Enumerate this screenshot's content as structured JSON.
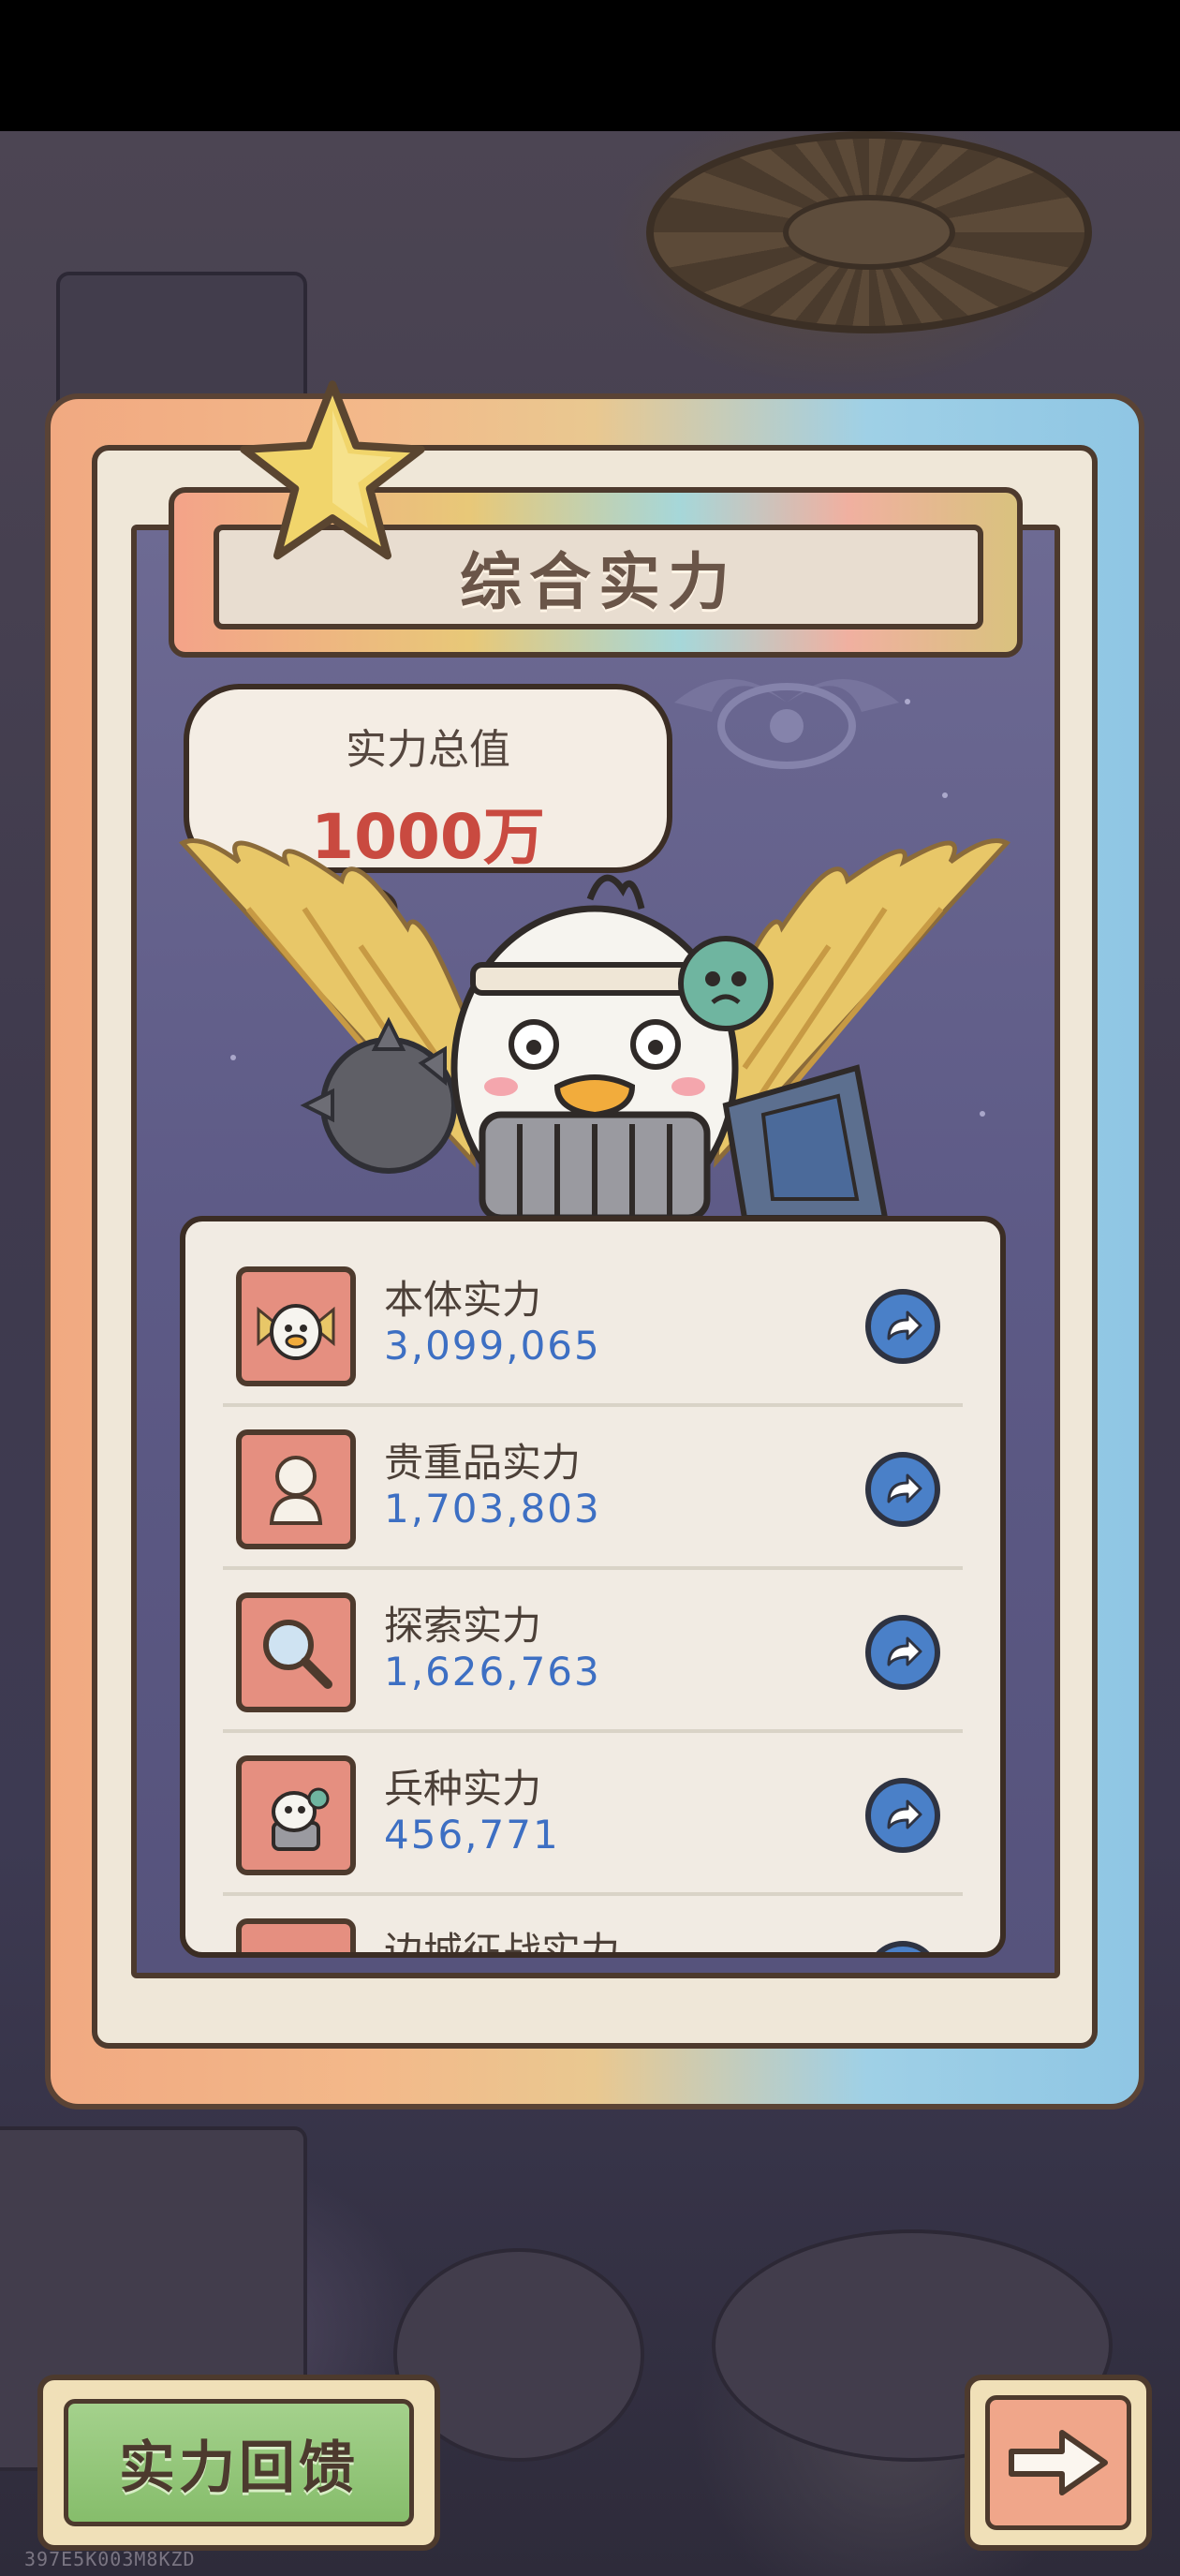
{
  "panel": {
    "title": "综合实力",
    "total_label": "实力总值",
    "total_value": "1000万"
  },
  "stats": [
    {
      "name": "本体实力",
      "value": "3,099,065",
      "icon": "duck-knight-icon"
    },
    {
      "name": "贵重品实力",
      "value": "1,703,803",
      "icon": "statue-bust-icon"
    },
    {
      "name": "探索实力",
      "value": "1,626,763",
      "icon": "magnifier-icon"
    },
    {
      "name": "兵种实力",
      "value": "456,771",
      "icon": "soldier-duck-icon"
    },
    {
      "name": "边城征战实力",
      "value": "",
      "icon": "partial-icon"
    }
  ],
  "buttons": {
    "feedback_label": "实力回馈",
    "next_icon": "arrow-right-icon",
    "go_icon": "share-arrow-icon"
  },
  "footer": {
    "build_tag": "397E5K003M8KZD"
  },
  "colors": {
    "accent_red": "#c94a40",
    "value_blue": "#3d6fc3",
    "panel_purple": "#5d5a86"
  }
}
